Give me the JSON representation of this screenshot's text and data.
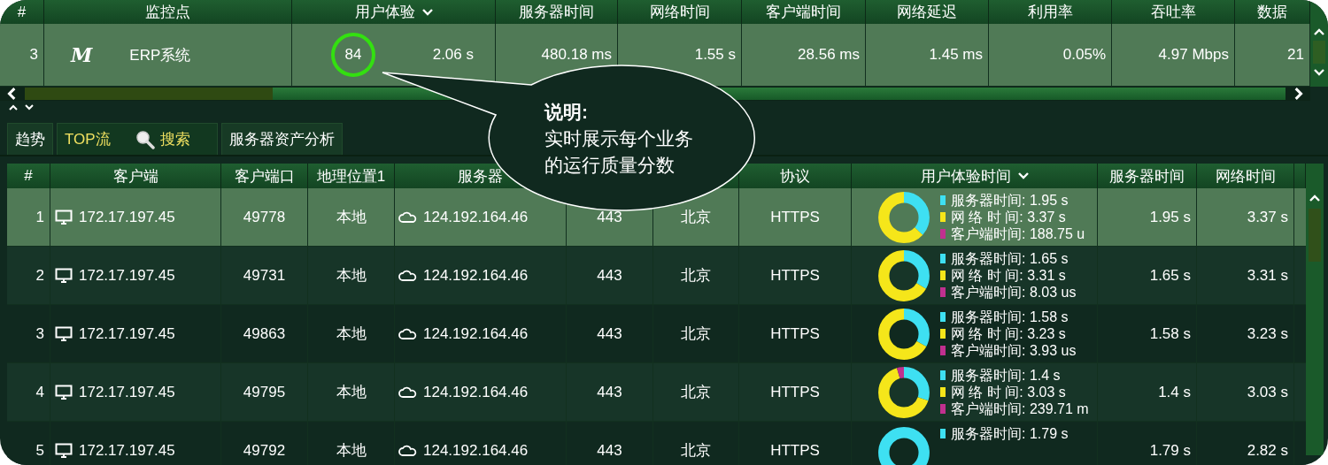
{
  "monitor_table": {
    "columns": [
      "#",
      "监控点",
      "用户体验",
      "服务器时间",
      "网络时间",
      "客户端时间",
      "网络延迟",
      "利用率",
      "吞吐率",
      "数据"
    ],
    "rows": [
      {
        "index": "3",
        "logo": "M",
        "name": "ERP系统",
        "score": "84",
        "experience": "2.06 s",
        "server_time": "480.18 ms",
        "network_time": "1.55 s",
        "client_time": "28.56 ms",
        "latency": "1.45 ms",
        "utilization": "0.05%",
        "throughput": "4.97 Mbps",
        "data": "21",
        "selected": true
      }
    ]
  },
  "tabs": [
    {
      "label": "趋势",
      "selected": false
    },
    {
      "label": "TOP流",
      "selected": true,
      "search_button": "搜索"
    },
    {
      "label": "服务器资产分析",
      "selected": false
    }
  ],
  "flow_table": {
    "columns": [
      "#",
      "客户端",
      "客户端口",
      "地理位置1",
      "服务器",
      "",
      "",
      "协议",
      "用户体验时间",
      "服务器时间",
      "网络时间"
    ],
    "rows": [
      {
        "index": "1",
        "client": "172.17.197.45",
        "client_port": "49778",
        "client_geo": "本地",
        "server": "124.192.164.46",
        "server_port": "443",
        "server_geo": "北京",
        "protocol": "HTTPS",
        "legend": [
          {
            "text": "服务器时间: 1.95 s",
            "color": "#3ee0f2"
          },
          {
            "text": "网 络 时 间: 3.37 s",
            "color": "#f5e61a"
          },
          {
            "text": "客户端时间: 188.75 u",
            "color": "#c0308f"
          }
        ],
        "server_time": "1.95 s",
        "network_time": "3.37 s",
        "selected": true
      },
      {
        "index": "2",
        "client": "172.17.197.45",
        "client_port": "49731",
        "client_geo": "本地",
        "server": "124.192.164.46",
        "server_port": "443",
        "server_geo": "北京",
        "protocol": "HTTPS",
        "legend": [
          {
            "text": "服务器时间: 1.65 s",
            "color": "#3ee0f2"
          },
          {
            "text": "网 络 时 间: 3.31 s",
            "color": "#f5e61a"
          },
          {
            "text": "客户端时间: 8.03 us",
            "color": "#c0308f"
          }
        ],
        "server_time": "1.65 s",
        "network_time": "3.31 s",
        "selected": false
      },
      {
        "index": "3",
        "client": "172.17.197.45",
        "client_port": "49863",
        "client_geo": "本地",
        "server": "124.192.164.46",
        "server_port": "443",
        "server_geo": "北京",
        "protocol": "HTTPS",
        "legend": [
          {
            "text": "服务器时间: 1.58 s",
            "color": "#3ee0f2"
          },
          {
            "text": "网 络 时 间: 3.23 s",
            "color": "#f5e61a"
          },
          {
            "text": "客户端时间: 3.93 us",
            "color": "#c0308f"
          }
        ],
        "server_time": "1.58 s",
        "network_time": "3.23 s",
        "selected": false
      },
      {
        "index": "4",
        "client": "172.17.197.45",
        "client_port": "49795",
        "client_geo": "本地",
        "server": "124.192.164.46",
        "server_port": "443",
        "server_geo": "北京",
        "protocol": "HTTPS",
        "legend": [
          {
            "text": "服务器时间: 1.4 s",
            "color": "#3ee0f2"
          },
          {
            "text": "网 络 时 间: 3.03 s",
            "color": "#f5e61a"
          },
          {
            "text": "客户端时间: 239.71 m",
            "color": "#c0308f"
          }
        ],
        "server_time": "1.4 s",
        "network_time": "3.03 s",
        "selected": false
      },
      {
        "index": "5",
        "client": "172.17.197.45",
        "client_port": "49792",
        "client_geo": "本地",
        "server": "124.192.164.46",
        "server_port": "443",
        "server_geo": "北京",
        "protocol": "HTTPS",
        "legend": [
          {
            "text": "服务器时间: 1.79 s",
            "color": "#3ee0f2"
          }
        ],
        "server_time": "1.79 s",
        "network_time": "2.82 s",
        "selected": false
      }
    ]
  },
  "callout": {
    "title": "说明:",
    "lines": [
      "实时展示每个业务",
      "的运行质量分数"
    ]
  }
}
